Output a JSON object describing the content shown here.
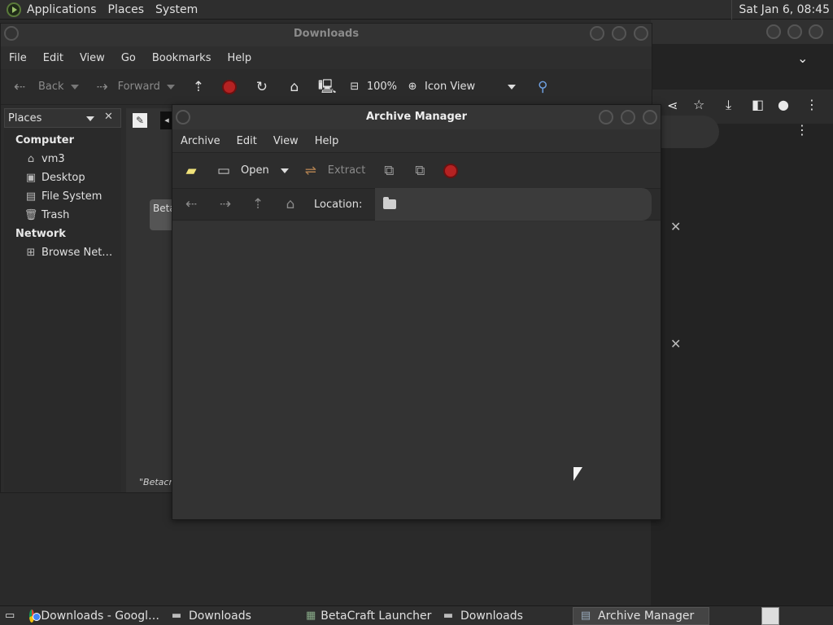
{
  "top_panel": {
    "menus": [
      "Applications",
      "Places",
      "System"
    ],
    "clock": "Sat Jan  6, 08:45"
  },
  "file_manager": {
    "title": "Downloads",
    "menu": [
      "File",
      "Edit",
      "View",
      "Go",
      "Bookmarks",
      "Help"
    ],
    "toolbar": {
      "back": "Back",
      "forward": "Forward",
      "zoom": "100%",
      "view_mode": "Icon View"
    },
    "sidebar": {
      "header": "Places",
      "computer_label": "Computer",
      "computer_items": [
        "vm3",
        "Desktop",
        "File System",
        "Trash"
      ],
      "network_label": "Network",
      "network_items": [
        "Browse Net…"
      ]
    },
    "file_tile_label": "Beta",
    "status_text": "\"Betacra"
  },
  "archive_manager": {
    "title": "Archive Manager",
    "menu": [
      "Archive",
      "Edit",
      "View",
      "Help"
    ],
    "toolbar": {
      "open": "Open",
      "extract": "Extract"
    },
    "location_label": "Location:"
  },
  "taskbar": {
    "items": [
      "Downloads - Googl…",
      "Downloads",
      "BetaCraft Launcher …",
      "Downloads",
      "Archive Manager"
    ]
  }
}
